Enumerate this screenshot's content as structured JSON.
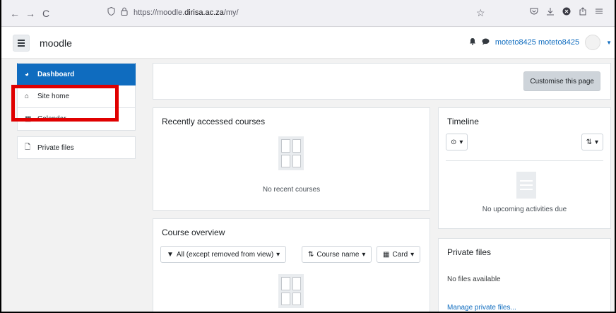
{
  "browser": {
    "back_icon": "←",
    "forward_icon": "→",
    "reload_icon": "C",
    "url_prefix": "https://moodle.",
    "url_host": "dirisa.ac.za",
    "url_path": "/my/"
  },
  "navbar": {
    "brand": "moodle",
    "username": "moteto8425 moteto8425"
  },
  "sidebar": {
    "items": [
      {
        "label": "Dashboard",
        "icon": "dashboard-icon"
      },
      {
        "label": "Site home",
        "icon": "home-icon"
      },
      {
        "label": "Calendar",
        "icon": "calendar-icon"
      },
      {
        "label": "Private files",
        "icon": "file-icon"
      }
    ]
  },
  "header": {
    "customise_label": "Customise this page"
  },
  "recent": {
    "title": "Recently accessed courses",
    "empty": "No recent courses"
  },
  "overview": {
    "title": "Course overview",
    "filter_label": "All (except removed from view)",
    "sort_label": "Course name",
    "view_label": "Card"
  },
  "timeline": {
    "title": "Timeline",
    "empty": "No upcoming activities due"
  },
  "private_files": {
    "title": "Private files",
    "empty": "No files available",
    "manage_link": "Manage private files..."
  },
  "colors": {
    "accent": "#0f6cbf",
    "highlight": "#e00000"
  }
}
